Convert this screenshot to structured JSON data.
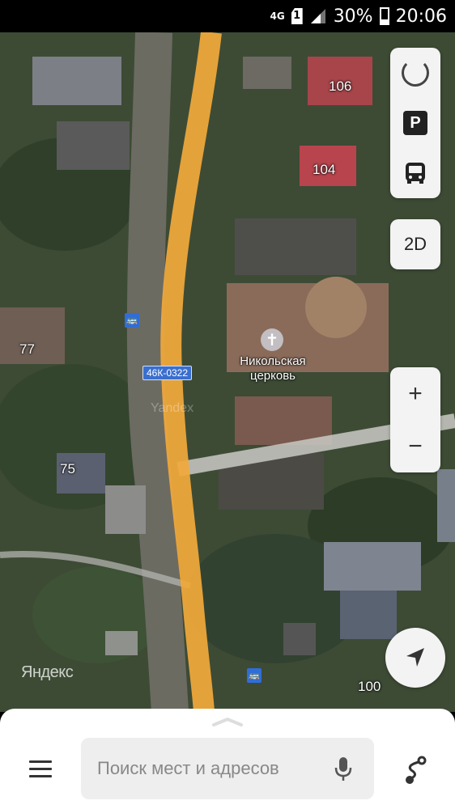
{
  "status_bar": {
    "network": "4G",
    "sim": "1",
    "battery": "30%",
    "time": "20:06"
  },
  "map": {
    "house_numbers": {
      "h106": "106",
      "h104": "104",
      "h77": "77",
      "h75": "75",
      "h100": "100"
    },
    "poi": {
      "church_line1": "Никольская",
      "church_line2": "церковь"
    },
    "road_badge": "46К-0322",
    "bus_stop_glyph": "🚌",
    "watermark": "Яндекс",
    "faint_mark": "Yandex"
  },
  "controls": {
    "parking_label": "P",
    "mode_label": "2D",
    "zoom_in": "+",
    "zoom_out": "−"
  },
  "search": {
    "placeholder": "Поиск мест и адресов"
  },
  "colors": {
    "highlighted_road": "#f2a93b",
    "bus_stop": "#2f6ed9",
    "road_badge": "#3a6fcf"
  }
}
